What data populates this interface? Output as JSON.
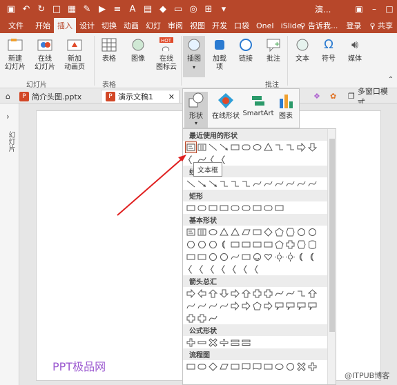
{
  "titlebar": {
    "title": "演..."
  },
  "tabs": [
    "文件",
    "开始",
    "插入",
    "设计",
    "切换",
    "动画",
    "幻灯",
    "审阅",
    "视图",
    "开发",
    "口袋",
    "OneI",
    "iSlide"
  ],
  "tabs_right": {
    "tell": "♀ 告诉我...",
    "login": "登录",
    "share": "♀ 共享"
  },
  "ribbon": {
    "new_slide": "新建\n幻灯片",
    "online_slide": "在线\n幻灯片",
    "new_anim": "新加\n动画页",
    "table": "表格",
    "image": "图像",
    "online_icon": "在线\n图标云",
    "illus": "插图",
    "addins": "加载\n项",
    "link": "链接",
    "comment": "批注",
    "text": "文本",
    "symbol": "符号",
    "media": "媒体",
    "grp_slides": "幻灯片",
    "grp_table": "表格",
    "grp_comment": "批注",
    "hot": "HOT"
  },
  "doctabs": {
    "tab1": "简介头图.pptx",
    "tab2": "演示文稿1",
    "multi": "多窗口模式"
  },
  "shapebar": {
    "shape": "形状",
    "online": "在线形状",
    "smartart": "SmartArt",
    "chart": "图表"
  },
  "gallery": {
    "recent": "最近使用的形状",
    "lines": "线条",
    "rect": "矩形",
    "basic": "基本形状",
    "arrows": "箭头总汇",
    "formula": "公式形状",
    "flow": "流程图"
  },
  "tooltip": "文本框",
  "leftpane": {
    "text": "幻灯片"
  },
  "watermark": "PPT极品网",
  "watermark2": "@ITPUB博客",
  "colors": {
    "accent": "#b7472a",
    "ribbon": "#f3f3f3",
    "watermark": "#9b59d0"
  }
}
